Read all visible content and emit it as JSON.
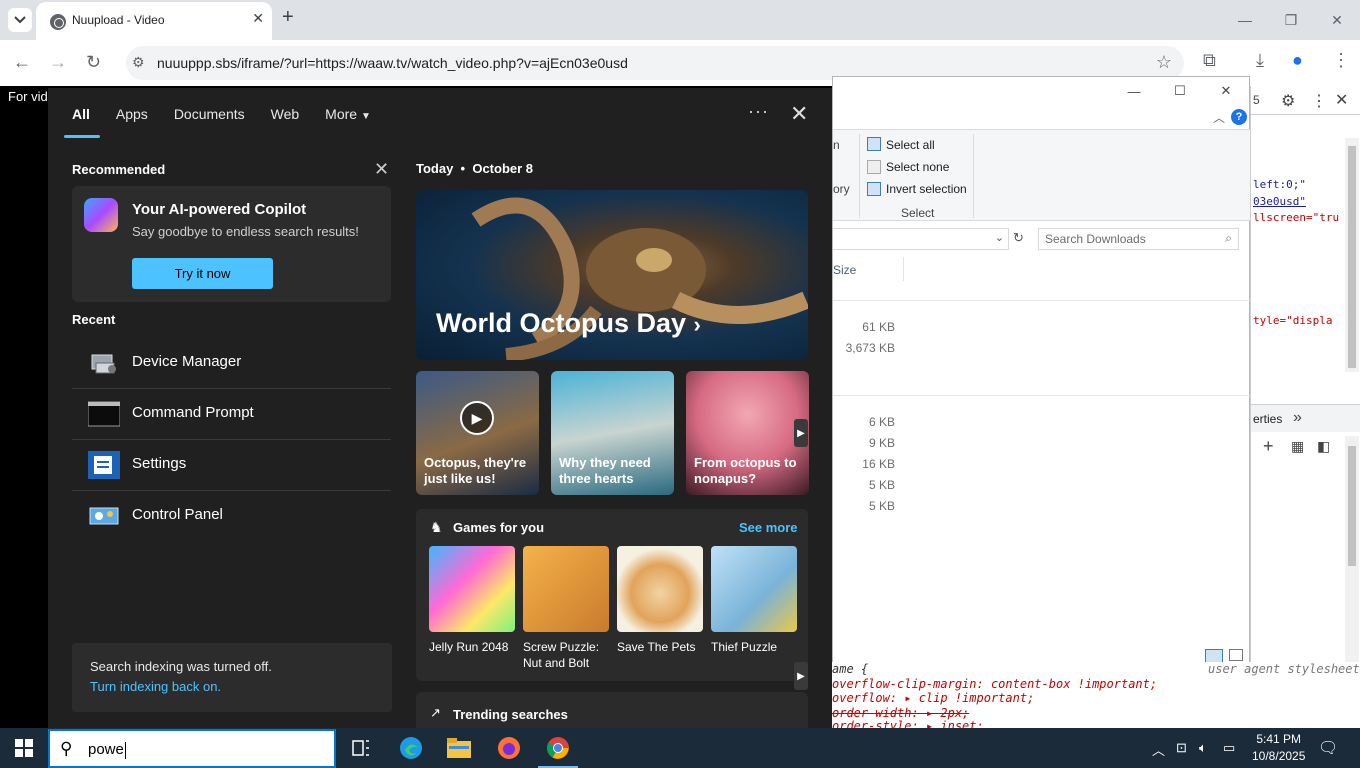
{
  "browser": {
    "tab_title": "Nuupload - Video",
    "url": "nuuuppp.sbs/iframe/?url=https://waaw.tv/watch_video.php?v=ajEcn03e0usd",
    "page_text": "For vid"
  },
  "explorer": {
    "ribbon": {
      "select_all": "Select all",
      "select_none": "Select none",
      "invert_selection": "Invert selection",
      "group_label": "Select",
      "partial_left_1": "n",
      "partial_left_2": "ory"
    },
    "search_placeholder": "Search Downloads",
    "column_size": "Size",
    "sizes_group1": [
      "61 KB",
      "3,673 KB"
    ],
    "sizes_group2": [
      "6 KB",
      "9 KB",
      "16 KB",
      "5 KB",
      "5 KB"
    ]
  },
  "devtools": {
    "tab_count": "5",
    "code_lines": [
      "left:0;\"",
      "03e0usd\"",
      "llscreen=\"tru",
      "tyle=\"displa"
    ],
    "panel_label": "erties",
    "css_lines": [
      "ame {",
      "overflow-clip-margin: content-box !important;",
      "overflow: ▸ clip !important;",
      "order-width: ▸ 2px;",
      "order-style: ▸ inset;"
    ],
    "user_agent_label": "user agent stylesheet"
  },
  "search_panel": {
    "tabs": [
      "All",
      "Apps",
      "Documents",
      "Web",
      "More"
    ],
    "recommended_title": "Recommended",
    "copilot": {
      "heading": "Your AI-powered Copilot",
      "subtitle": "Say goodbye to endless search results!",
      "button": "Try it now"
    },
    "recent_title": "Recent",
    "recent_items": [
      {
        "label": "Device Manager",
        "icon": "device-manager-icon"
      },
      {
        "label": "Command Prompt",
        "icon": "command-prompt-icon"
      },
      {
        "label": "Settings",
        "icon": "settings-icon"
      },
      {
        "label": "Control Panel",
        "icon": "control-panel-icon"
      }
    ],
    "index_note": {
      "text": "Search indexing was turned off.",
      "link": "Turn indexing back on."
    },
    "today_label": "Today",
    "today_date": "October 8",
    "hero_title": "World Octopus Day",
    "thumbs": [
      "Octopus, they're just like us!",
      "Why they need three hearts",
      "From octopus to nonapus?"
    ],
    "games_title": "Games for you",
    "see_more": "See more",
    "games": [
      "Jelly Run 2048",
      "Screw Puzzle: Nut and Bolt",
      "Save The Pets",
      "Thief Puzzle"
    ],
    "trending_title": "Trending searches"
  },
  "taskbar": {
    "search_text": "powe",
    "time": "5:41 PM",
    "date": "10/8/2025"
  },
  "colors": {
    "accent": "#4cc2ff",
    "panel_bg": "#202020",
    "taskbar_bg": "#1c2b3a"
  }
}
